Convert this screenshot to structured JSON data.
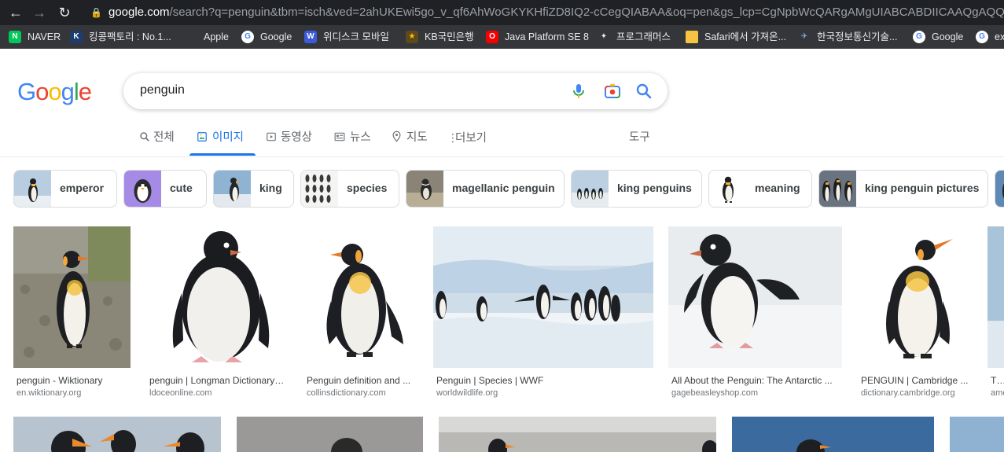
{
  "browser": {
    "url_host": "google.com",
    "url_rest": "/search?q=penguin&tbm=isch&ved=2ahUKEwi5go_v_qf6AhWoGKYKHfiZD8IQ2-cCegQIABAA&oq=pen&gs_lcp=CgNpbWcQARgAMgUIABCABDIICAAQgAQQsQMyBQgA",
    "bookmarks": [
      {
        "label": "NAVER",
        "icon": "naver-icon",
        "color": "#03c75a",
        "glyph": "N"
      },
      {
        "label": "킹콩팩토리 : No.1...",
        "icon": "kingkong-icon",
        "color": "#1c3d6e",
        "glyph": "K"
      },
      {
        "label": "Apple",
        "icon": "apple-icon",
        "color": "#5f6368",
        "glyph": ""
      },
      {
        "label": "Google",
        "icon": "google-icon",
        "color": "#ffffff",
        "glyph": "G"
      },
      {
        "label": "위디스크 모바일",
        "icon": "wedisk-icon",
        "color": "#3b5bdb",
        "glyph": "W"
      },
      {
        "label": "KB국민은행",
        "icon": "kb-icon",
        "color": "#ffbc00",
        "glyph": "★"
      },
      {
        "label": "Java Platform SE 8",
        "icon": "oracle-icon",
        "color": "#f80000",
        "glyph": "O"
      },
      {
        "label": "프로그래머스",
        "icon": "programmers-icon",
        "color": "#263747",
        "glyph": "P"
      },
      {
        "label": "Safari에서 가져온...",
        "icon": "folder-icon",
        "color": "#f6c344",
        "glyph": ""
      },
      {
        "label": "한국정보통신기술...",
        "icon": "ktia-icon",
        "color": "#2b5da8",
        "glyph": "K"
      },
      {
        "label": "Google",
        "icon": "google-icon",
        "color": "#ffffff",
        "glyph": "G"
      },
      {
        "label": "ex",
        "icon": "google-icon",
        "color": "#ffffff",
        "glyph": "G"
      }
    ]
  },
  "search": {
    "query": "penguin",
    "logo": [
      "G",
      "o",
      "o",
      "g",
      "l",
      "e"
    ],
    "logo_colors": [
      "#4285f4",
      "#ea4335",
      "#fbbc05",
      "#4285f4",
      "#34a853",
      "#ea4335"
    ]
  },
  "tabs": [
    {
      "label": "전체",
      "icon": "search-icon",
      "glyph": "🔍"
    },
    {
      "label": "이미지",
      "icon": "image-icon",
      "glyph": "▣",
      "active": true
    },
    {
      "label": "동영상",
      "icon": "video-icon",
      "glyph": "▶"
    },
    {
      "label": "뉴스",
      "icon": "news-icon",
      "glyph": "▤"
    },
    {
      "label": "지도",
      "icon": "map-pin-icon",
      "glyph": "◉"
    },
    {
      "label": "더보기",
      "icon": "more-vert-icon",
      "glyph": "⋮"
    },
    {
      "label": "도구",
      "icon": "",
      "glyph": ""
    }
  ],
  "chips": [
    {
      "label": "emperor"
    },
    {
      "label": "cute"
    },
    {
      "label": "king"
    },
    {
      "label": "species"
    },
    {
      "label": "magellanic penguin"
    },
    {
      "label": "king penguins"
    },
    {
      "label": "meaning"
    },
    {
      "label": "king penguin pictures"
    }
  ],
  "results": [
    {
      "title": "penguin - Wiktionary",
      "source": "en.wiktionary.org"
    },
    {
      "title": "penguin | Longman Dictionary ...",
      "source": "ldoceonline.com"
    },
    {
      "title": "Penguin definition and ...",
      "source": "collinsdictionary.com"
    },
    {
      "title": "Penguin | Species | WWF",
      "source": "worldwildlife.org"
    },
    {
      "title": "All About the Penguin: The Antarctic ...",
      "source": "gagebeasleyshop.com"
    },
    {
      "title": "PENGUIN | Cambridge ...",
      "source": "dictionary.cambridge.org"
    },
    {
      "title": "The",
      "source": "ame"
    }
  ],
  "colors": {
    "accent": "#1a73e8",
    "chrome_dark": "#202124",
    "bookmark_bar": "#35363a"
  }
}
